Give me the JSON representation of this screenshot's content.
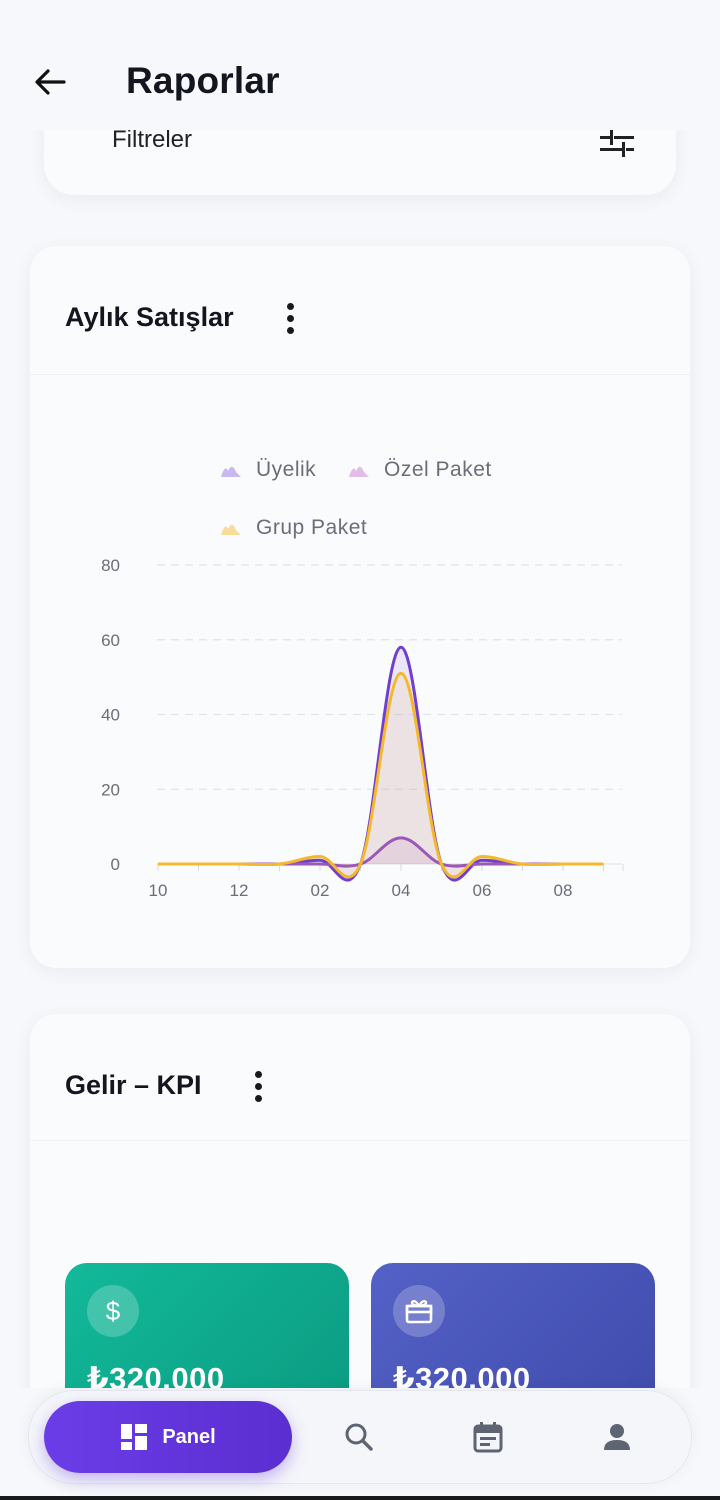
{
  "appbar": {
    "title": "Raporlar",
    "back_icon": "arrow-left-icon"
  },
  "filters": {
    "label": "Filtreler",
    "icon": "tune-icon"
  },
  "sales_card": {
    "title": "Aylık Satışlar",
    "menu_icon": "more-vert-icon"
  },
  "kpi_card": {
    "title": "Gelir – KPI",
    "menu_icon": "more-vert-icon",
    "tiles": [
      {
        "icon": "dollar-icon",
        "value": "₺320.000",
        "color": "#12b99a"
      },
      {
        "icon": "package-icon",
        "value": "₺320.000",
        "color": "#4e5bbf"
      }
    ]
  },
  "chart_data": {
    "type": "area",
    "x": [
      "10",
      "11",
      "12",
      "01",
      "02",
      "03",
      "04",
      "05",
      "06",
      "07",
      "08",
      "09"
    ],
    "x_tick_labels": [
      "10",
      "12",
      "02",
      "04",
      "06",
      "08"
    ],
    "ylim": [
      0,
      80
    ],
    "y_ticks": [
      0,
      20,
      40,
      60,
      80
    ],
    "grid": true,
    "legend_position": "top",
    "series": [
      {
        "name": "Üyelik",
        "color": "#6f3fd0",
        "values": [
          0,
          0,
          0,
          0,
          1,
          0,
          58,
          0,
          1,
          0,
          0,
          0
        ]
      },
      {
        "name": "Özel Paket",
        "color": "#9b59b6",
        "values": [
          0,
          0,
          0,
          0,
          0,
          0,
          7,
          0,
          0,
          0,
          0,
          0
        ]
      },
      {
        "name": "Grup Paket",
        "color": "#f5b82a",
        "values": [
          0,
          0,
          0,
          0,
          2,
          0,
          51,
          0,
          2,
          0,
          0,
          0
        ]
      }
    ]
  },
  "bottom_nav": {
    "active_label": "Panel",
    "active_icon": "dashboard-icon",
    "items": [
      {
        "icon": "search-icon"
      },
      {
        "icon": "calendar-icon"
      },
      {
        "icon": "person-icon"
      }
    ]
  }
}
